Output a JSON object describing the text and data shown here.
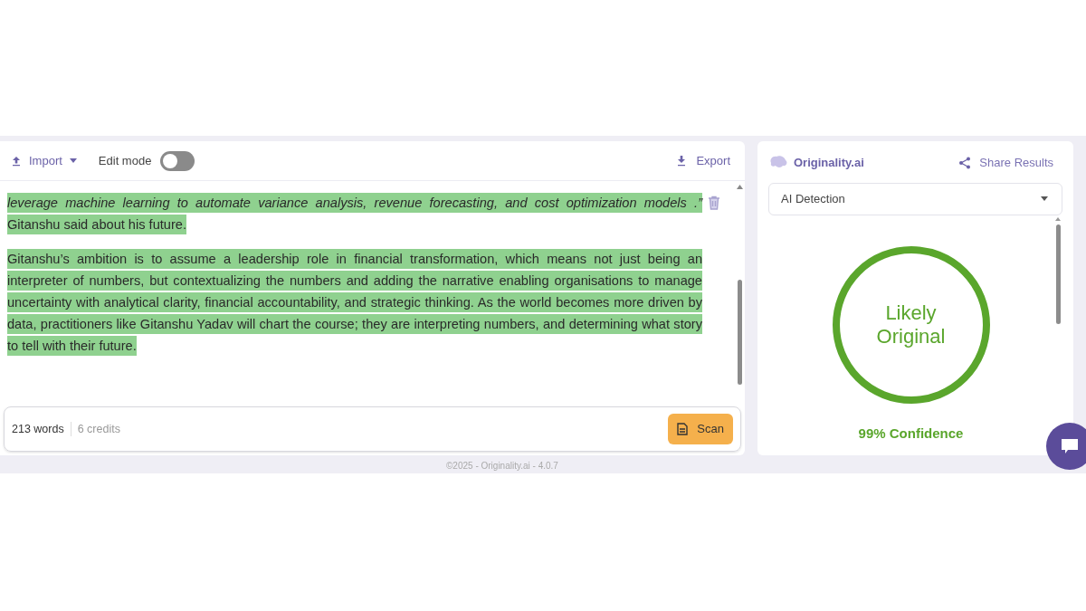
{
  "toolbar": {
    "import_label": "Import",
    "edit_mode": {
      "label": "Edit mode",
      "on": false
    },
    "export_label": "Export"
  },
  "paragraphs": [
    {
      "text": "*leverage machine learning to automate variance analysis, revenue forecasting, and cost optimization models .”* Gitanshu said about his future.",
      "highlighted": true
    },
    {
      "text": "Gitanshu’s ambition is to assume a leadership role in financial transformation, which means not just being an interpreter of numbers, but contextualizing the numbers and adding the narrative enabling organisations to manage uncertainty with analytical clarity, financial accountability, and strategic thinking.  As the world becomes more driven by data, practitioners like Gitanshu Yadav will chart the course; they are interpreting numbers, and determining what story to tell with their future.",
      "highlighted": true
    }
  ],
  "footer": {
    "words": "213 words",
    "credits": "6 credits",
    "scan_label": "Scan"
  },
  "version": "©2025 - Originality.ai - 4.0.7",
  "results": {
    "brand": "Originality.ai",
    "share_label": "Share Results",
    "mode": "AI Detection",
    "verdict_line_1": "Likely",
    "verdict_line_2": "Original",
    "confidence": "99% Confidence"
  }
}
